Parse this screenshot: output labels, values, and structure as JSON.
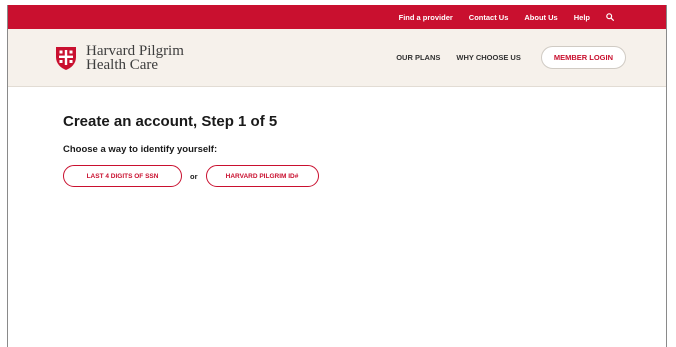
{
  "utility_nav": {
    "items": [
      "Find a provider",
      "Contact Us",
      "About Us",
      "Help"
    ],
    "search_icon": "search-icon"
  },
  "header": {
    "logo_line1": "Harvard Pilgrim",
    "logo_line2": "Health Care",
    "nav": {
      "our_plans": "OUR PLANS",
      "why_choose_us": "WHY CHOOSE US",
      "member_login": "MEMBER LOGIN"
    }
  },
  "main": {
    "title": "Create an account, Step 1 of 5",
    "subtitle": "Choose a way to identify yourself:",
    "option_ssn": "LAST 4 DIGITS OF SSN",
    "or_label": "or",
    "option_id": "HARVARD PILGRIM ID#"
  },
  "colors": {
    "brand_red": "#c9102f",
    "header_bg": "#f6f1eb",
    "text_dark": "#1a1a1a"
  }
}
